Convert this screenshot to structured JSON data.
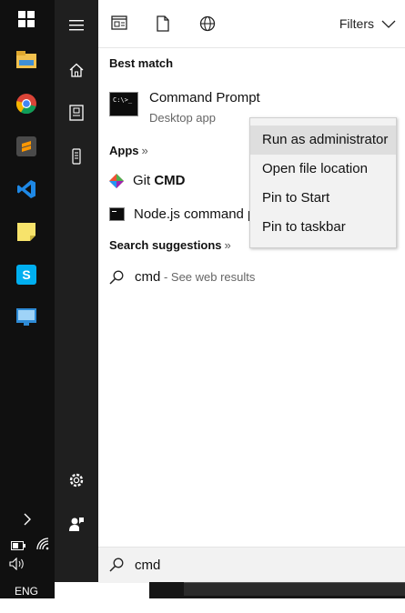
{
  "taskbar": {
    "apps": [
      {
        "icon": "windows-start-icon",
        "color": "#ffffff"
      },
      {
        "icon": "file-explorer-icon",
        "color": "#f2c14e"
      },
      {
        "icon": "chrome-icon",
        "color": "#db4437"
      },
      {
        "icon": "sublime-text-icon",
        "color": "#ff9800"
      },
      {
        "icon": "vscode-icon",
        "color": "#1e88e5"
      },
      {
        "icon": "sticky-notes-icon",
        "color": "#f7e36b"
      },
      {
        "icon": "skype-icon",
        "color": "#00aff0"
      },
      {
        "icon": "remote-desktop-icon",
        "color": "#2e8bd6"
      }
    ],
    "language": "ENG"
  },
  "rail": {
    "items": [
      "hamburger-menu-icon",
      "home-icon",
      "documents-icon",
      "device-icon",
      "settings-icon",
      "user-feedback-icon"
    ]
  },
  "scope": {
    "icons": [
      "apps-scope-icon",
      "documents-scope-icon",
      "web-scope-icon"
    ],
    "filters_label": "Filters"
  },
  "results": {
    "best_match_heading": "Best match",
    "best_match": {
      "title": "Command Prompt",
      "subtitle": "Desktop app",
      "icon_text": "C:\\>_"
    },
    "apps_heading": "Apps",
    "apps_chevron": "»",
    "apps": [
      {
        "prefix": "Git ",
        "bold": "CMD",
        "icon": "git-icon"
      },
      {
        "prefix": "Node.js command p",
        "bold": "",
        "icon": "command-prompt-small-icon"
      }
    ],
    "suggestions_heading": "Search suggestions",
    "suggestions_chevron": "»",
    "suggestion": {
      "query": "cmd",
      "suffix": " - See web results"
    }
  },
  "context_menu": {
    "items": [
      "Run as administrator",
      "Open file location",
      "Pin to Start",
      "Pin to taskbar"
    ],
    "highlighted_index": 0
  },
  "search_box": {
    "value": "cmd"
  },
  "colors": {
    "taskbar_bg": "#101010",
    "rail_bg": "#1f1f1f",
    "menu_bg": "#f2f2f2",
    "menu_hover": "#dedede"
  }
}
